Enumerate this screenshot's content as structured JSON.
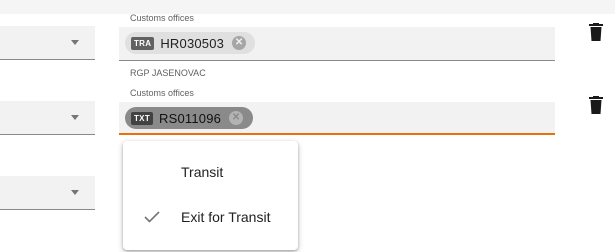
{
  "rows": [
    {
      "office_label": "Customs offices",
      "chip_badge": "TRA",
      "chip_value": "HR030503",
      "chip_close": "✕"
    },
    {
      "office_name": "RGP JASENOVAC",
      "office_label": "Customs offices",
      "chip_badge": "TXT",
      "chip_value": "RS011096",
      "chip_close": "✕"
    }
  ],
  "menu": {
    "items": [
      {
        "label": "Transit",
        "selected": false
      },
      {
        "label": "Exit for Transit",
        "selected": true
      }
    ]
  },
  "icons": {
    "dropdown": "chevron-down-icon",
    "delete": "trash-icon",
    "check": "check-icon",
    "close": "close-icon"
  },
  "colors": {
    "active_underline": "#e8710a",
    "field_fill": "#f2f2f2",
    "chip": "#e0e0e0"
  }
}
